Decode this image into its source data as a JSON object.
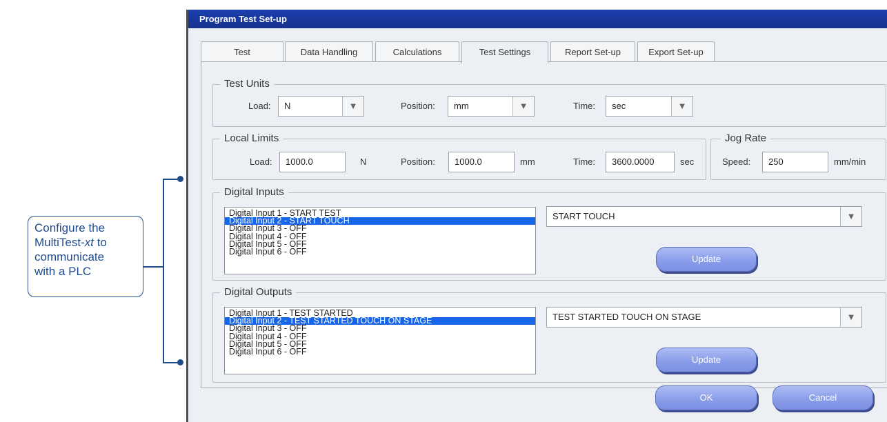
{
  "annotation": {
    "line1": "Configure the",
    "line2_pre": "MultiTest-",
    "line2_em": "xt",
    "line2_post": " to",
    "line3": "communicate",
    "line4": "with a PLC"
  },
  "window": {
    "title": "Program Test Set-up"
  },
  "tabs": [
    {
      "label": "Test",
      "active": false
    },
    {
      "label": "Data Handling",
      "active": false
    },
    {
      "label": "Calculations",
      "active": false
    },
    {
      "label": "Test Settings",
      "active": true
    },
    {
      "label": "Report Set-up",
      "active": false
    },
    {
      "label": "Export Set-up",
      "active": false
    }
  ],
  "test_units": {
    "title": "Test Units",
    "load_label": "Load:",
    "load_value": "N",
    "position_label": "Position:",
    "position_value": "mm",
    "time_label": "Time:",
    "time_value": "sec",
    "dropdown_glyph": "▼"
  },
  "local_limits": {
    "title": "Local Limits",
    "load_label": "Load:",
    "load_value": "1000.0",
    "load_unit": "N",
    "position_label": "Position:",
    "position_value": "1000.0",
    "position_unit": "mm",
    "time_label": "Time:",
    "time_value": "3600.0000",
    "time_unit": "sec"
  },
  "jog_rate": {
    "title": "Jog Rate",
    "speed_label": "Speed:",
    "speed_value": "250",
    "speed_unit": "mm/min"
  },
  "digital_inputs": {
    "title": "Digital Inputs",
    "items": [
      "Digital Input 1 - START TEST",
      "Digital Input 2 - START TOUCH",
      "Digital Input 3 - OFF",
      "Digital Input 4 - OFF",
      "Digital Input 5 - OFF",
      "Digital Input 6 - OFF"
    ],
    "selected_index": 1,
    "selection_value": "START TOUCH",
    "update_label": "Update"
  },
  "digital_outputs": {
    "title": "Digital Outputs",
    "items": [
      "Digital Input 1 - TEST STARTED",
      "Digital Input 2 - TEST STARTED TOUCH ON STAGE",
      "Digital Input 3 - OFF",
      "Digital Input 4 - OFF",
      "Digital Input 5 - OFF",
      "Digital Input 6 - OFF"
    ],
    "selected_index": 1,
    "selection_value": "TEST STARTED TOUCH ON STAGE",
    "update_label": "Update"
  },
  "footer": {
    "ok_label": "OK",
    "cancel_label": "Cancel"
  },
  "colors": {
    "title_bar": "#1b3fae",
    "selection": "#1766e8",
    "button": "#8da0ea",
    "annotation": "#1f4b8e"
  }
}
